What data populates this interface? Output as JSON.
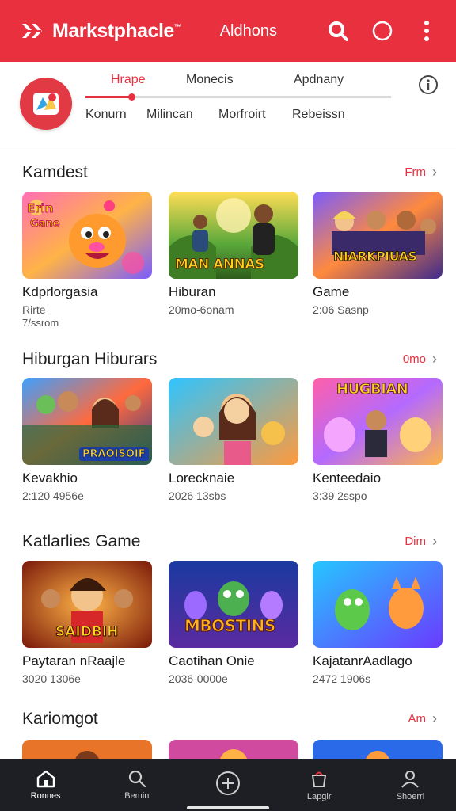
{
  "header": {
    "title": "Markstphacle",
    "trademark": "™",
    "link_label": "Aldhons",
    "bg_color": "#e8303f"
  },
  "subnav": {
    "tabs": [
      {
        "label": "Hrape",
        "active": true
      },
      {
        "label": "Monecis",
        "active": false
      },
      {
        "label": "Apdnany",
        "active": false
      }
    ],
    "tab_progress": 0.15,
    "filters": [
      "Konurn",
      "Milincan",
      "Morfroirt",
      "Rebeissn"
    ]
  },
  "sections": [
    {
      "title": "Kamdest",
      "more_label": "Frm",
      "cards": [
        {
          "title": "Kdprlorgasia",
          "sub": "Rirte",
          "sub2": "7/ssrom",
          "art": "mascot"
        },
        {
          "title": "Hiburan",
          "sub": "20mo-6onam",
          "art": "jungle",
          "banner": "MAN ANNAS"
        },
        {
          "title": "Game",
          "sub": "2:06 Sasnp",
          "art": "group",
          "banner": "NIARKPIUAS"
        }
      ]
    },
    {
      "title": "Hiburgan Hiburars",
      "more_label": "0mo",
      "cards": [
        {
          "title": "Kevakhio",
          "sub": "2:120 4956e",
          "art": "crowd",
          "banner": "PRAOISOIF"
        },
        {
          "title": "Lorecknaie",
          "sub": "2026 13sbs",
          "art": "kids",
          "banner": ""
        },
        {
          "title": "Kenteedaio",
          "sub": "3:39 2sspo",
          "art": "pets",
          "banner": "HUGBIAN"
        }
      ]
    },
    {
      "title": "Katlarlies Game",
      "more_label": "Dim",
      "cards": [
        {
          "title": "Paytaran nRaajle",
          "sub": "3020 1306e",
          "art": "heroes",
          "banner": "SAIDBIH"
        },
        {
          "title": "Caotihan Onie",
          "sub": "2036-0000e",
          "art": "monsters",
          "banner": "MBOSTINS"
        },
        {
          "title": "KajatanrAadlago",
          "sub": "2472 1906s",
          "art": "critters",
          "banner": ""
        }
      ]
    },
    {
      "title": "Kariomgot",
      "more_label": "Am",
      "cards": []
    }
  ],
  "bottom_nav": [
    {
      "label": "Ronnes",
      "icon": "home-icon",
      "active": true
    },
    {
      "label": "Bemin",
      "icon": "search-icon",
      "active": false
    },
    {
      "label": "",
      "icon": "add-circle-icon",
      "active": false
    },
    {
      "label": "Lapgir",
      "icon": "bag-icon",
      "active": false
    },
    {
      "label": "Shoerrl",
      "icon": "profile-icon",
      "active": false
    }
  ]
}
